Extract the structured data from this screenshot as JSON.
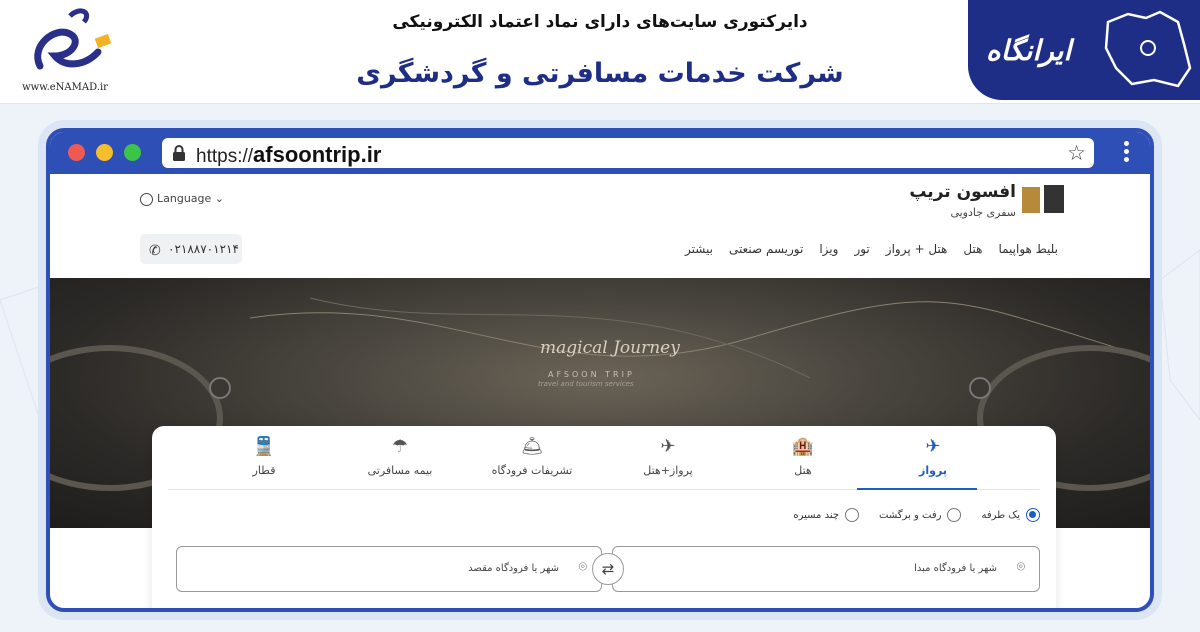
{
  "banner": {
    "enamad_url": "www.eNAMAD.ir",
    "directory_title": "دایرکتوری سایت‌های دارای نماد اعتماد الکترونیکی",
    "company_title": "شرکت خدمات مسافرتی و گردشگری",
    "irangah_wordmark": "ایرانگاه"
  },
  "browser": {
    "url_prefix": "https://",
    "url_domain": "afsoontrip.ir",
    "dot_colors": [
      "#ee5a52",
      "#f5be2f",
      "#3cc448"
    ],
    "accent": "#2d4fb6"
  },
  "site": {
    "brand_name": "افسون تریپ",
    "brand_tagline": "سفری جادویی",
    "language_label": "Language",
    "phone": "۰۲۱۸۸۷۰۱۲۱۴",
    "nav": [
      "بلیط هواپیما",
      "هتل",
      "هتل + پرواز",
      "تور",
      "ویزا",
      "توریسم صنعتی",
      "بیشتر"
    ],
    "hero_title": "magical Journey",
    "hero_sub": "AFSOON TRIP",
    "hero_sub2": "travel and tourism services"
  },
  "search": {
    "tabs": [
      {
        "label": "پرواز",
        "icon": "flight-icon",
        "glyph": "✈"
      },
      {
        "label": "هتل",
        "icon": "hotel-icon",
        "glyph": "🏨"
      },
      {
        "label": "پرواز+هتل",
        "icon": "flight-hotel-icon",
        "glyph": "✈"
      },
      {
        "label": "تشریفات فرودگاه",
        "icon": "airport-vip-icon",
        "glyph": "🛎"
      },
      {
        "label": "بیمه مسافرتی",
        "icon": "umbrella-icon",
        "glyph": "☂"
      },
      {
        "label": "قطار",
        "icon": "train-icon",
        "glyph": "🚆"
      }
    ],
    "trip_types": [
      "یک طرفه",
      "رفت و برگشت",
      "چند مسیره"
    ],
    "selected_trip_type": "یک طرفه",
    "origin_placeholder": "شهر یا فرودگاه مبدا",
    "destination_placeholder": "شهر یا فرودگاه مقصد",
    "accent": "#1e5bc6"
  }
}
